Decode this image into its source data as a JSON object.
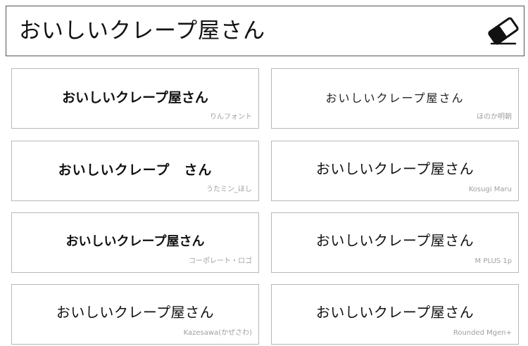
{
  "input": {
    "value": "おいしいクレープ屋さん",
    "clear_icon": "eraser-icon"
  },
  "cards": [
    {
      "sample": "おいしいクレープ屋さん",
      "font_name": "りんフォント"
    },
    {
      "sample": "おいしいクレープ屋さん",
      "font_name": "ほのか明朝"
    },
    {
      "sample": "おいしいクレープ　さん",
      "font_name": "うたミン_ほし"
    },
    {
      "sample": "おいしいクレープ屋さん",
      "font_name": "Kosugi Maru"
    },
    {
      "sample": "おいしいクレープ屋さん",
      "font_name": "コーポレート・ロゴ"
    },
    {
      "sample": "おいしいクレープ屋さん",
      "font_name": "M PLUS 1p"
    },
    {
      "sample": "おいしいクレープ屋さん",
      "font_name": "Kazesawa(かぜさわ)"
    },
    {
      "sample": "おいしいクレープ屋さん",
      "font_name": "Rounded Mgen+"
    }
  ]
}
